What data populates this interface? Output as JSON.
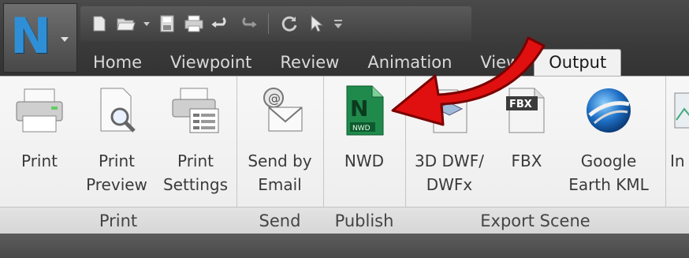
{
  "app_button": {
    "logo_letter": "N",
    "icon": "navisworks-logo-icon"
  },
  "quick_access": {
    "icons": [
      "new-file-icon",
      "open-folder-icon",
      "dropdown-icon",
      "save-icon",
      "print-icon",
      "undo-icon",
      "redo-icon",
      "refresh-icon",
      "select-cursor-icon",
      "customize-dropdown-icon"
    ]
  },
  "tabs": [
    {
      "label": "Home"
    },
    {
      "label": "Viewpoint"
    },
    {
      "label": "Review"
    },
    {
      "label": "Animation"
    },
    {
      "label": "View"
    },
    {
      "label": "Output",
      "active": true
    }
  ],
  "panels": {
    "print": {
      "label": "Print",
      "tools": [
        {
          "line1": "Print",
          "line2": "",
          "icon": "printer-icon"
        },
        {
          "line1": "Print",
          "line2": "Preview",
          "icon": "print-preview-icon"
        },
        {
          "line1": "Print",
          "line2": "Settings",
          "icon": "print-settings-icon"
        }
      ]
    },
    "send": {
      "label": "Send",
      "tools": [
        {
          "line1": "Send by",
          "line2": "Email",
          "icon": "email-icon"
        }
      ]
    },
    "publish": {
      "label": "Publish",
      "tools": [
        {
          "line1": "NWD",
          "line2": "",
          "icon": "nwd-file-icon",
          "badge": "NWD"
        }
      ]
    },
    "export": {
      "label": "Export Scene",
      "tools": [
        {
          "line1": "3D DWF/",
          "line2": "DWFx",
          "icon": "dwf-icon"
        },
        {
          "line1": "FBX",
          "line2": "",
          "icon": "fbx-icon",
          "badge": "FBX"
        },
        {
          "line1": "Google",
          "line2": "Earth KML",
          "icon": "google-earth-icon"
        },
        {
          "line1": "In",
          "line2": "",
          "icon": "image-export-icon"
        }
      ]
    }
  },
  "colors": {
    "accent_green": "#1f8a4c",
    "arrow_red": "#e01010",
    "logo_blue": "#2f8fd6"
  }
}
